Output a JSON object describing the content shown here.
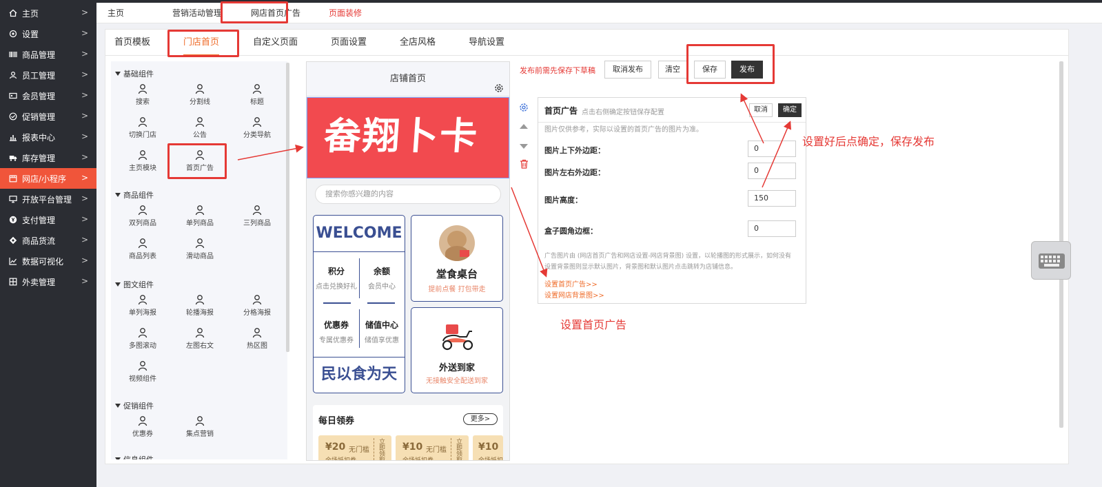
{
  "sidebar": {
    "items": [
      {
        "label": "主页",
        "icon": "home-icon"
      },
      {
        "label": "设置",
        "icon": "gear-icon"
      },
      {
        "label": "商品管理",
        "icon": "barcode-icon"
      },
      {
        "label": "员工管理",
        "icon": "user-icon"
      },
      {
        "label": "会员管理",
        "icon": "member-card-icon"
      },
      {
        "label": "促销管理",
        "icon": "check-circle-icon"
      },
      {
        "label": "报表中心",
        "icon": "bar-chart-icon"
      },
      {
        "label": "库存管理",
        "icon": "truck-icon"
      },
      {
        "label": "网店/小程序",
        "icon": "store-icon"
      },
      {
        "label": "开放平台管理",
        "icon": "monitor-icon"
      },
      {
        "label": "支付管理",
        "icon": "yen-circle-icon"
      },
      {
        "label": "商品货流",
        "icon": "flow-icon"
      },
      {
        "label": "数据可视化",
        "icon": "line-chart-icon"
      },
      {
        "label": "外卖管理",
        "icon": "shop-icon"
      }
    ]
  },
  "topnav": {
    "tabs": [
      "主页",
      "营销活动管理",
      "网店首页广告",
      "页面装修"
    ]
  },
  "subtabs": [
    "首页模板",
    "门店首页",
    "自定义页面",
    "页面设置",
    "全店风格",
    "导航设置"
  ],
  "palette": {
    "groups": [
      {
        "title": "基础组件",
        "items": [
          "搜索",
          "分割线",
          "标题",
          "切换门店",
          "公告",
          "分类导航",
          "主页模块",
          "首页广告"
        ]
      },
      {
        "title": "商品组件",
        "items": [
          "双列商品",
          "单列商品",
          "三列商品",
          "商品列表",
          "滑动商品"
        ]
      },
      {
        "title": "图文组件",
        "items": [
          "单列海报",
          "轮播海报",
          "分格海报",
          "多图滚动",
          "左图右文",
          "热区图",
          "视频组件"
        ]
      },
      {
        "title": "促销组件",
        "items": [
          "优惠券",
          "集点营销"
        ]
      },
      {
        "title": "信息组件",
        "items": []
      }
    ]
  },
  "phone": {
    "title": "店铺首页",
    "banner_text": "畚翔卜卡",
    "search_placeholder": "搜索你感兴趣的内容",
    "welcome": "WELCOME",
    "points_title": "积分",
    "points_sub": "点击兑换好礼",
    "balance_title": "余额",
    "balance_sub": "会员中心",
    "coupon_title": "优惠券",
    "coupon_sub": "专属优惠券",
    "stored_title": "储值中心",
    "stored_sub": "储值享优惠",
    "slogan": "民以食为天",
    "dine_title": "堂食桌台",
    "dine_sub": "提前点餐 打包带走",
    "delivery_title": "外送到家",
    "delivery_sub": "无接触安全配送到家",
    "daily_coupon": "每日领券",
    "more": "更多>",
    "coupons": [
      {
        "amount": "¥20",
        "cond": "无门槛",
        "desc": "全场抵扣券",
        "action": "立即领取"
      },
      {
        "amount": "¥10",
        "cond": "无门槛",
        "desc": "全场抵扣券",
        "action": "立即领取"
      },
      {
        "amount": "¥10",
        "cond": "",
        "desc": "全场抵扣",
        "action": ""
      }
    ]
  },
  "actions": {
    "warning": "发布前需先保存下草稿",
    "cancel_publish": "取消发布",
    "clear": "清空",
    "save": "保存",
    "publish": "发布"
  },
  "editor": {
    "title": "首页广告",
    "hint": "点击右侧确定按钮保存配置",
    "cancel": "取消",
    "confirm": "确定",
    "desc": "图片仅供参考，实际以设置的首页广告的图片为准。",
    "fields": [
      {
        "label": "图片上下外边距：",
        "value": "0"
      },
      {
        "label": "图片左右外边距：",
        "value": "0"
      },
      {
        "label": "图片高度：",
        "value": "150"
      },
      {
        "label": "盒子圆角边框：",
        "value": "0"
      }
    ],
    "note_line1": "广告图片由 (网店首页广告和网店设置-网店背景图) 设置，以轮播图的形式展示，如何没有",
    "note_line2": "设置背景图则显示默认图片，背景图和默认图片点击跳转为店铺信息。",
    "link1": "设置首页广告>>",
    "link2": "设置网店背景图>>"
  },
  "annotations": {
    "confirm_note": "设置好后点确定，保存发布",
    "ad_note": "设置首页广告"
  },
  "colors": {
    "sidebar_bg": "#2b2d33",
    "sidebar_active": "#f0553a",
    "accent_orange": "#ef6c2a",
    "annotation_red": "#e53935",
    "navy": "#3a4f92"
  }
}
